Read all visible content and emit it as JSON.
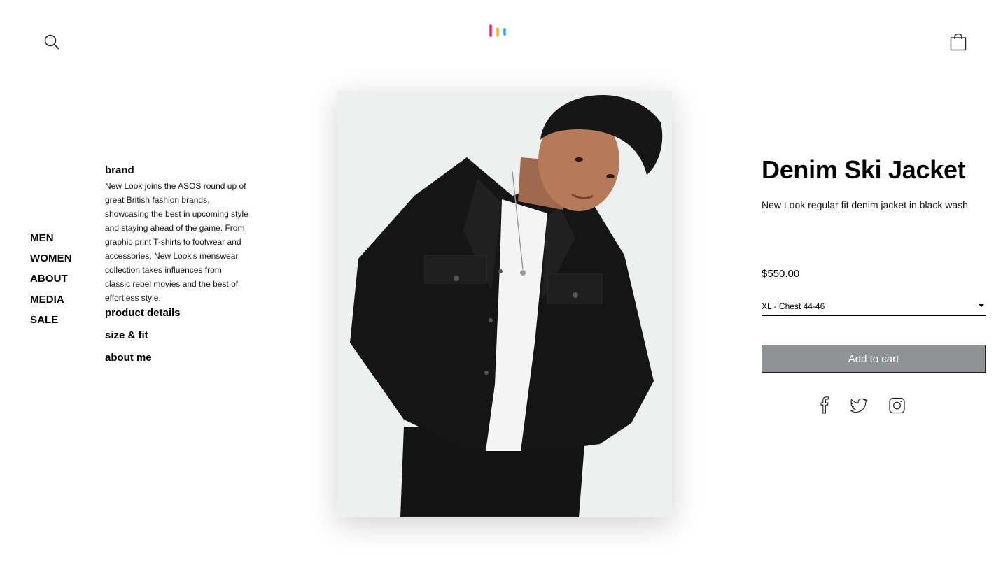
{
  "header": {
    "search_icon": "search-icon",
    "logo_icon": "brand-logo",
    "logo_colors": [
      "#e8237b",
      "#f4b81c",
      "#1ea8e8"
    ],
    "cart_icon": "shopping-bag-icon"
  },
  "nav": {
    "items": [
      "MEN",
      "WOMEN",
      "ABOUT",
      "MEDIA",
      "SALE"
    ]
  },
  "info": {
    "heading": "brand",
    "body": "New Look joins the ASOS round up of great British fashion brands, showcasing the best in upcoming style and staying ahead of the game. From graphic print T-shirts to footwear and accessories, New Look's menswear collection takes influences from classic rebel movies and the best of effortless style.",
    "links": [
      "product details",
      "size & fit",
      "about me"
    ]
  },
  "product": {
    "title": "Denim Ski Jacket",
    "description": "New Look regular fit denim jacket in black wash",
    "price": "$550.00",
    "size": "XL - Chest 44-46",
    "add_to_cart": "Add to cart",
    "button_color": "#909296"
  },
  "social": {
    "icons": [
      "facebook-icon",
      "twitter-icon",
      "instagram-icon"
    ]
  }
}
